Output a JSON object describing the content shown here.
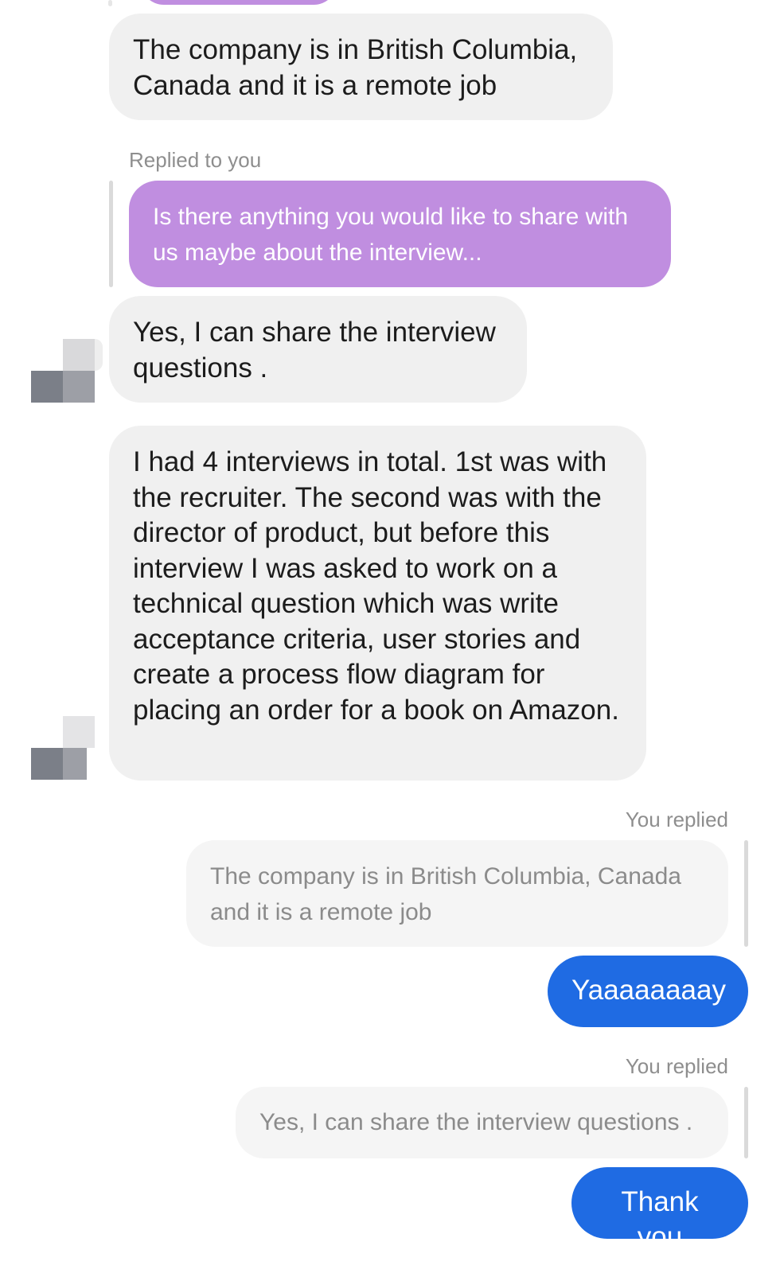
{
  "conversation": {
    "top_partial_bubble_color": "#c08ee0",
    "messages": [
      {
        "id": "msg-company-location",
        "text": "The company is in British Columbia, Canada and it is a remote job"
      },
      {
        "id": "msg-reply-1",
        "reply_label": "Replied to you",
        "quoted_text": "Is there anything you would like to share with us maybe about the interview...",
        "quoted_color": "#c08ee0"
      },
      {
        "id": "msg-share-questions",
        "text": "Yes, I can share the interview questions ."
      },
      {
        "id": "msg-interview-details",
        "text": "I had 4 interviews in total. 1st was with the recruiter. The second was with the director of product, but before this interview I was asked to work on a technical question which was write acceptance criteria, user stories and create a process flow diagram for placing an order for a book on Amazon."
      },
      {
        "id": "msg-you-reply-1",
        "reply_label": "You replied",
        "quoted_text": "The company is in British Columbia, Canada and it is a remote job",
        "response_text": "Yaaaaaaaay",
        "response_color": "#1f6be3"
      },
      {
        "id": "msg-you-reply-2",
        "reply_label": "You replied",
        "quoted_text": "Yes, I can share the interview questions .",
        "response_text": "Thank you",
        "response_color": "#1f6be3"
      }
    ]
  },
  "colors": {
    "incoming_bubble": "#f0f0f0",
    "outgoing_bubble": "#1f6be3",
    "quoted_purple": "#c08ee0",
    "label_gray": "#8e8e8e"
  },
  "icons": {
    "avatar_1": "avatar-pixelated",
    "avatar_2": "avatar-pixelated"
  }
}
